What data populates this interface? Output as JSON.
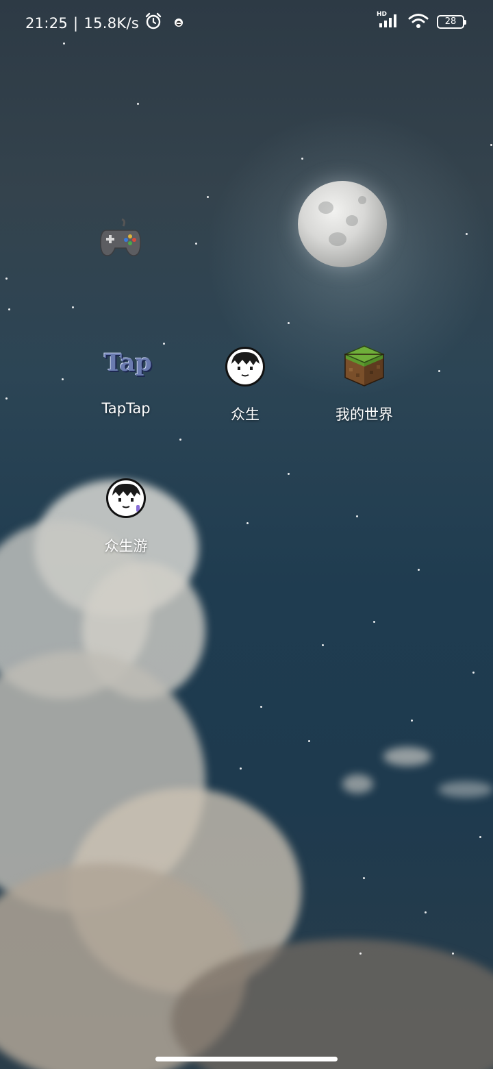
{
  "status_bar": {
    "time": "21:25",
    "separator": "|",
    "network_speed": "15.8K/s",
    "alarm_icon": "alarm-clock-icon",
    "notification_icon": "app-notification-icon",
    "signal_label": "HD",
    "signal_icon": "cellular-signal-icon",
    "wifi_icon": "wifi-icon",
    "battery_level": "28"
  },
  "widgets": {
    "gamepad_icon": "gamepad-icon"
  },
  "apps": [
    {
      "label": "TapTap",
      "icon": "taptap-icon",
      "icon_text": "Tap"
    },
    {
      "label": "众生",
      "icon": "zhongsheng-face-icon"
    },
    {
      "label": "我的世界",
      "icon": "minecraft-grass-block-icon"
    },
    {
      "label": "众生游",
      "icon": "zhongshengyou-face-icon"
    }
  ],
  "navigation": {
    "gesture_bar": "home-indicator"
  }
}
